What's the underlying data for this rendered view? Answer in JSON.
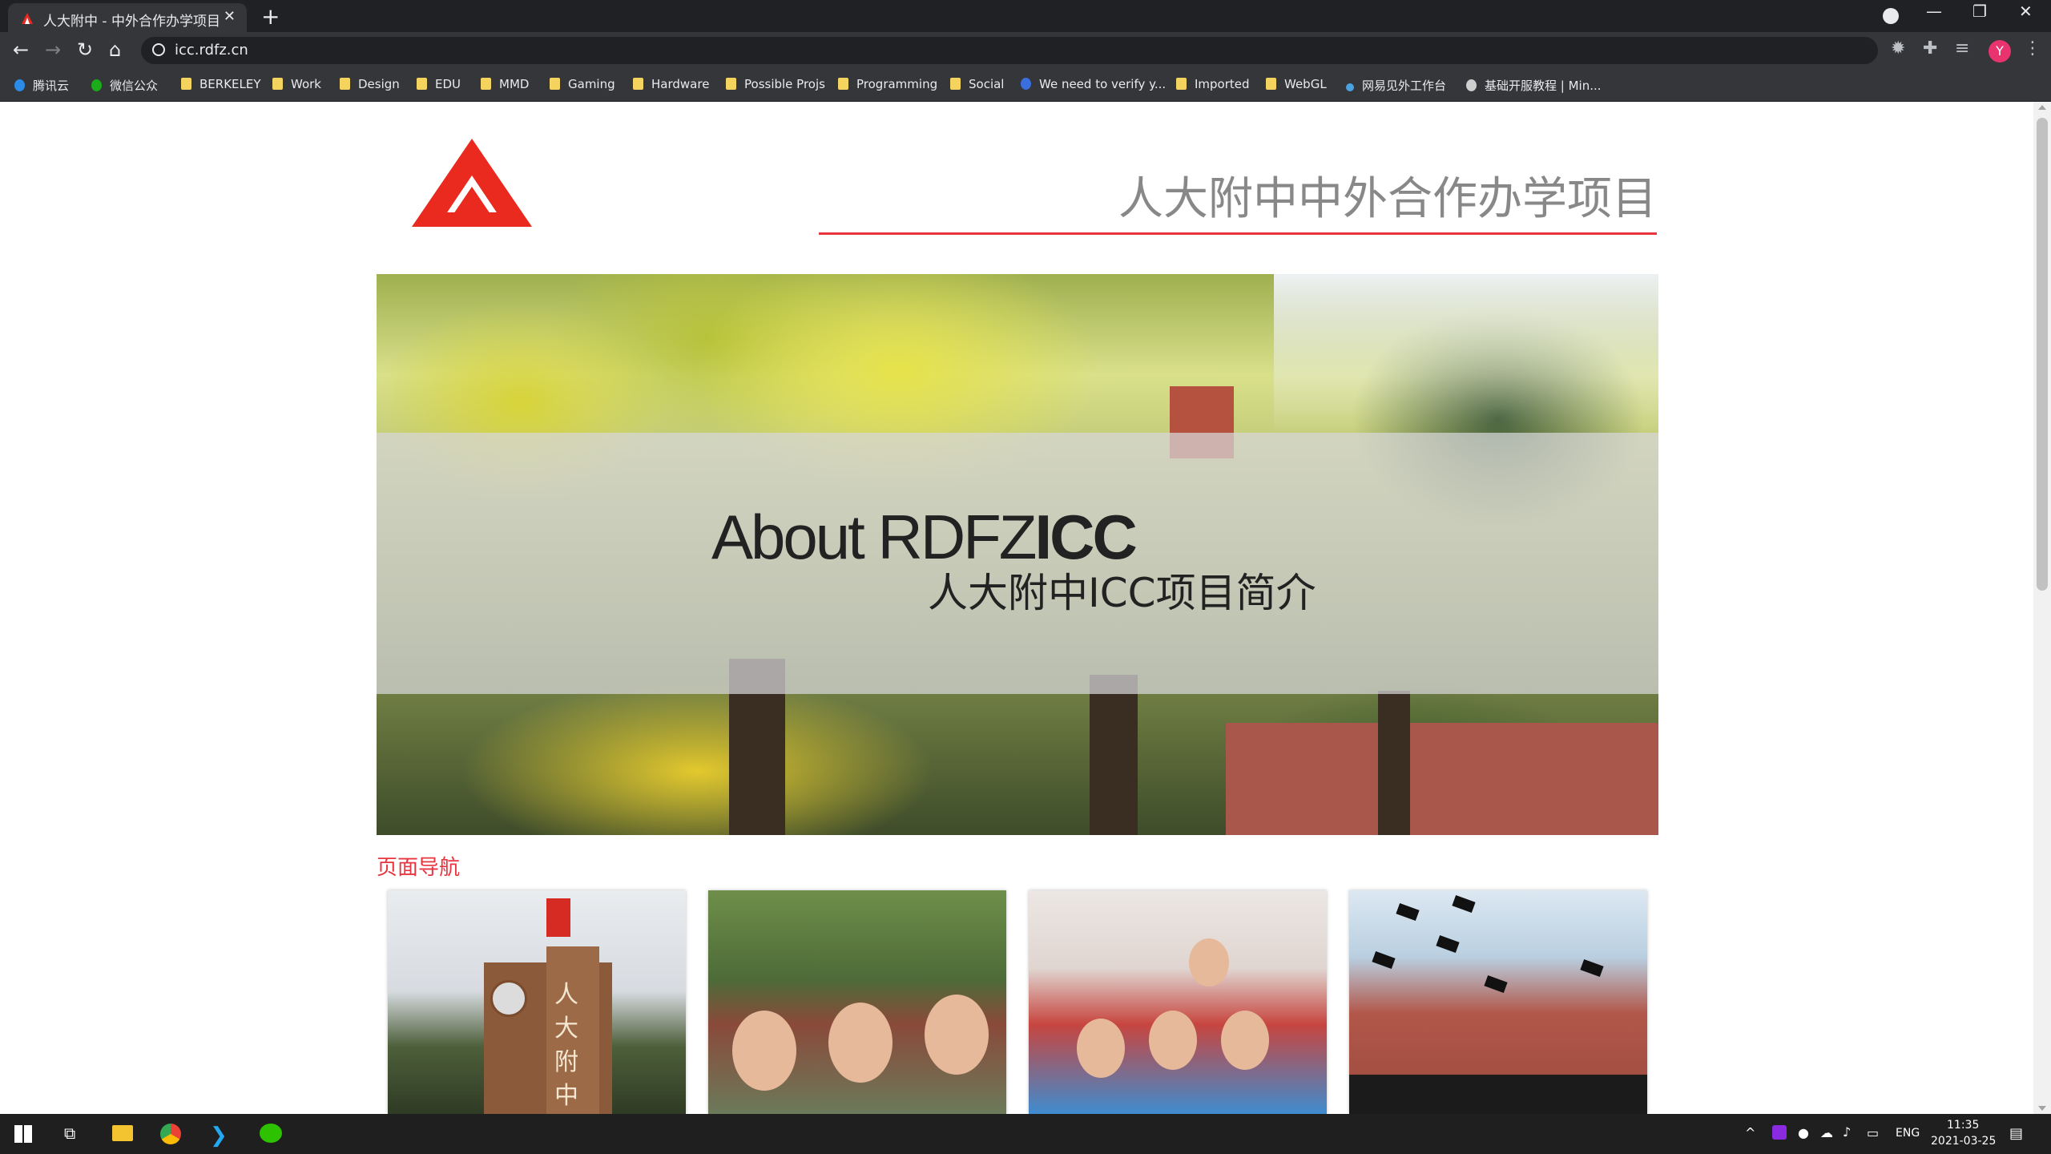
{
  "browser": {
    "tab": {
      "title": "人大附中 - 中外合作办学项目",
      "close": "✕"
    },
    "new_tab": "+",
    "window": {
      "minimize": "—",
      "restore": "❐",
      "close": "✕"
    },
    "nav": {
      "back": "←",
      "forward": "→",
      "reload": "↻",
      "home": "⌂"
    },
    "url": "icc.rdfz.cn",
    "profile_initial": "Y",
    "bookmarks": [
      {
        "label": "腾讯云",
        "icon": "cloud-icon"
      },
      {
        "label": "微信公众",
        "icon": "wechat-icon"
      },
      {
        "label": "BERKELEY",
        "icon": "folder-icon"
      },
      {
        "label": "Work",
        "icon": "folder-icon"
      },
      {
        "label": "Design",
        "icon": "folder-icon"
      },
      {
        "label": "EDU",
        "icon": "folder-icon"
      },
      {
        "label": "MMD",
        "icon": "folder-icon"
      },
      {
        "label": "Gaming",
        "icon": "folder-icon"
      },
      {
        "label": "Hardware",
        "icon": "folder-icon"
      },
      {
        "label": "Possible Projs",
        "icon": "folder-icon"
      },
      {
        "label": "Programming",
        "icon": "folder-icon"
      },
      {
        "label": "Social",
        "icon": "folder-icon"
      },
      {
        "label": "We need to verify y...",
        "icon": "site-icon"
      },
      {
        "label": "Imported",
        "icon": "folder-icon"
      },
      {
        "label": "WebGL",
        "icon": "folder-icon"
      },
      {
        "label": "网易见外工作台",
        "icon": "site-icon"
      },
      {
        "label": "基础开服教程 | Min...",
        "icon": "globe-icon"
      }
    ]
  },
  "page": {
    "site_title": "人大附中中外合作办学项目",
    "hero": {
      "en_light": "About RDFZ",
      "en_bold": "ICC",
      "cn": "人大附中ICC项目简介"
    },
    "section_title": "页面导航",
    "card1_chars": "人大附中"
  },
  "taskbar": {
    "lang": "ENG",
    "time": "11:35",
    "date": "2021-03-25"
  },
  "colors": {
    "accent": "#e8343f",
    "logo_red": "#ea2a1e",
    "title_grey": "#888888"
  }
}
